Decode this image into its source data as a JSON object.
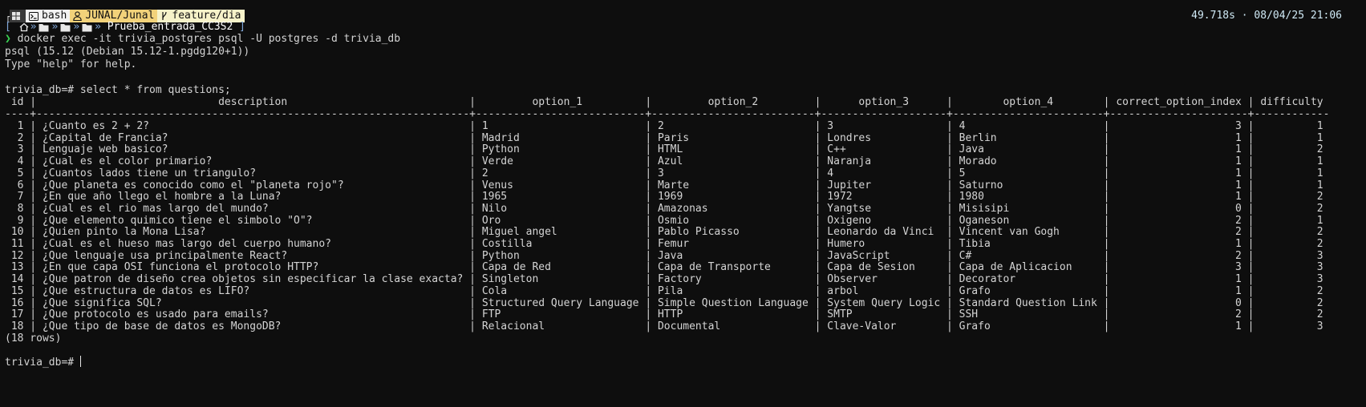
{
  "prompt": {
    "os_icon": "windows-icon",
    "shell": "bash",
    "user": "JUNAL/Junal",
    "branch": "feature/dia",
    "timing": "49.718s · 08/04/25 21:06",
    "path_current": "Prueba_entrada_CC3S2",
    "path_open": "[",
    "path_close": "]",
    "path_sep": "»"
  },
  "terminal": {
    "command": "docker exec -it trivia_postgres psql -U postgres -d trivia_db",
    "psql_version": "psql (15.12 (Debian 15.12-1.pgdg120+1))",
    "help_hint": "Type \"help\" for help.",
    "query_prompt": "trivia_db=# select * from questions;",
    "row_count": "(18 rows)",
    "final_prompt": "trivia_db=# "
  },
  "table": {
    "columns": [
      "id",
      "description",
      "option_1",
      "option_2",
      "option_3",
      "option_4",
      "correct_option_index",
      "difficulty"
    ],
    "rows": [
      [
        "1",
        "¿Cuanto es 2 + 2?",
        "1",
        "2",
        "3",
        "4",
        "3",
        "1"
      ],
      [
        "2",
        "¿Capital de Francia?",
        "Madrid",
        "Paris",
        "Londres",
        "Berlin",
        "1",
        "1"
      ],
      [
        "3",
        "Lenguaje web basico?",
        "Python",
        "HTML",
        "C++",
        "Java",
        "1",
        "2"
      ],
      [
        "4",
        "¿Cual es el color primario?",
        "Verde",
        "Azul",
        "Naranja",
        "Morado",
        "1",
        "1"
      ],
      [
        "5",
        "¿Cuantos lados tiene un triangulo?",
        "2",
        "3",
        "4",
        "5",
        "1",
        "1"
      ],
      [
        "6",
        "¿Que planeta es conocido como el \"planeta rojo\"?",
        "Venus",
        "Marte",
        "Jupiter",
        "Saturno",
        "1",
        "1"
      ],
      [
        "7",
        "¿En que año llego el hombre a la Luna?",
        "1965",
        "1969",
        "1972",
        "1980",
        "1",
        "2"
      ],
      [
        "8",
        "¿Cual es el rio mas largo del mundo?",
        "Nilo",
        "Amazonas",
        "Yangtse",
        "Misisipi",
        "0",
        "2"
      ],
      [
        "9",
        "¿Que elemento quimico tiene el simbolo \"O\"?",
        "Oro",
        "Osmio",
        "Oxigeno",
        "Oganeson",
        "2",
        "1"
      ],
      [
        "10",
        "¿Quien pinto la Mona Lisa?",
        "Miguel angel",
        "Pablo Picasso",
        "Leonardo da Vinci",
        "Vincent van Gogh",
        "2",
        "2"
      ],
      [
        "11",
        "¿Cual es el hueso mas largo del cuerpo humano?",
        "Costilla",
        "Femur",
        "Humero",
        "Tibia",
        "1",
        "2"
      ],
      [
        "12",
        "¿Que lenguaje usa principalmente React?",
        "Python",
        "Java",
        "JavaScript",
        "C#",
        "2",
        "3"
      ],
      [
        "13",
        "¿En que capa OSI funciona el protocolo HTTP?",
        "Capa de Red",
        "Capa de Transporte",
        "Capa de Sesion",
        "Capa de Aplicacion",
        "3",
        "3"
      ],
      [
        "14",
        "¿Que patron de diseño crea objetos sin especificar la clase exacta?",
        "Singleton",
        "Factory",
        "Observer",
        "Decorator",
        "1",
        "3"
      ],
      [
        "15",
        "¿Que estructura de datos es LIFO?",
        "Cola",
        "Pila",
        "arbol",
        "Grafo",
        "1",
        "2"
      ],
      [
        "16",
        "¿Que significa SQL?",
        "Structured Query Language",
        "Simple Question Language",
        "System Query Logic",
        "Standard Question Link",
        "0",
        "2"
      ],
      [
        "17",
        "¿Que protocolo es usado para emails?",
        "FTP",
        "HTTP",
        "SMTP",
        "SSH",
        "2",
        "2"
      ],
      [
        "18",
        "¿Que tipo de base de datos es MongoDB?",
        "Relacional",
        "Documental",
        "Clave-Valor",
        "Grafo",
        "1",
        "3"
      ]
    ]
  },
  "colors": {
    "background": "#0e0e0e",
    "text": "#d4d4d4",
    "prompt_chevron": "#39d353",
    "timing": "#cfe9f5",
    "path_blue": "#8fb8e8"
  }
}
